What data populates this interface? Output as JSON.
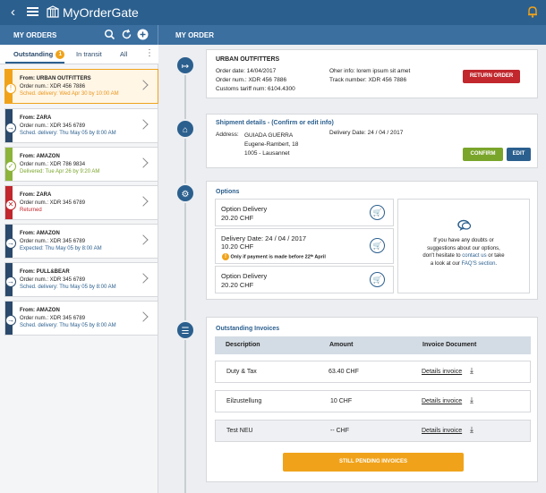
{
  "app": {
    "title": "MyOrderGate"
  },
  "sidebar": {
    "title": "MY ORDERS",
    "tabs": [
      {
        "label": "Outstanding",
        "badge": "1"
      },
      {
        "label": "In transit"
      },
      {
        "label": "All"
      }
    ],
    "orders": [
      {
        "from": "From: URBAN OUTFITTERS",
        "order": "Order num.: XDR 456 7886",
        "status": "Sched. delivery: Wed Apr 30 by 10:00 AM",
        "status_color": "#e8941a",
        "stripe": "#f0a31a",
        "status_icon": "!"
      },
      {
        "from": "From: ZARA",
        "order": "Order num.: XDR 345 6789",
        "status": "Sched. delivery: Thu May 05 by 8:00 AM",
        "status_color": "#2b5f8e",
        "stripe": "#2b4a6b",
        "status_icon": "→"
      },
      {
        "from": "From: AMAZON",
        "order": "Order num.: XDR 786 9834",
        "status": "Delivered: Tue Apr 26 by 9:20 AM",
        "status_color": "#7aa52b",
        "stripe": "#8cb43a",
        "status_icon": "✓"
      },
      {
        "from": "From: ZARA",
        "order": "Order num.: XDR 345 6789",
        "status": "Returned",
        "status_color": "#c1272d",
        "stripe": "#c1272d",
        "status_icon": "✕"
      },
      {
        "from": "From: AMAZON",
        "order": "Order num.: XDR 345 6789",
        "status": "Expected: Thu May 05 by 8:00 AM",
        "status_color": "#2b5f8e",
        "stripe": "#2b4a6b",
        "status_icon": "→"
      },
      {
        "from": "From: PULL&BEAR",
        "order": "Order num.: XDR 345 6789",
        "status": "Sched. delivery: Thu May 05 by 8:00 AM",
        "status_color": "#2b5f8e",
        "stripe": "#2b4a6b",
        "status_icon": "→"
      },
      {
        "from": "From: AMAZON",
        "order": "Order num.: XDR 345 6789",
        "status": "Sched. delivery: Thu May 05 by 8:00 AM",
        "status_color": "#2b5f8e",
        "stripe": "#2b4a6b",
        "status_icon": "→"
      }
    ]
  },
  "main": {
    "title": "MY ORDER",
    "order": {
      "merchant": "URBAN OUTFITTERS",
      "order_date": "Order date: 14/04/2017",
      "order_num": "Order num.: XDR 456 7886",
      "tariff": "Customs tariff num: 6104.4300",
      "other_info": "Oher info: lorem ipsum sit amet",
      "track": "Track number: XDR 456 7886",
      "return_label": "RETURN ORDER"
    },
    "shipment": {
      "title": "Shipment details - (Confirm or edit info)",
      "address_label": "Address:",
      "address_lines": [
        "GUIADA GUERRA",
        "Eugene-Rambert, 18",
        "1005 - Lausannet"
      ],
      "delivery_label": "Delivery Date:",
      "delivery_value": "24 / 04 / 2017",
      "confirm_label": "CONFIRM",
      "edit_label": "EDIT"
    },
    "options": {
      "title": "Options",
      "items": [
        {
          "name": "Option Delivery",
          "price": "20.20 CHF",
          "note": ""
        },
        {
          "name": "Delivery Date: 24 / 04 / 2017",
          "price": "10.20 CHF",
          "note": "Only if payment is made before 22ᵗʰ April"
        },
        {
          "name": "Option Delivery",
          "price": "20.20 CHF",
          "note": ""
        }
      ],
      "help": {
        "line1": "If you have any doubts or",
        "line2": "suggestions about our options,",
        "line3_pre": "don't hesitate to ",
        "line3_link": "contact us",
        "line3_post": " or take",
        "line4_pre": "a look at our ",
        "line4_link": "FAQ'S section",
        "line4_post": "."
      }
    },
    "invoices": {
      "title": "Outstanding Invoices",
      "headers": [
        "Description",
        "Amount",
        "Invoice Document"
      ],
      "rows": [
        {
          "desc": "Duty & Tax",
          "amount": "63.40 CHF",
          "doc": "Details invoice"
        },
        {
          "desc": "Eilzustellung",
          "amount": "10 CHF",
          "doc": "Details invoice"
        },
        {
          "desc": "Test NEU",
          "amount": "-- CHF",
          "doc": "Details invoice"
        }
      ],
      "pending_label": "STILL PENDING INVOICES"
    }
  },
  "colors": {
    "brand": "#2b5f8e",
    "accent": "#f0a31a",
    "return": "#c1272d",
    "confirm": "#7aa52b"
  }
}
